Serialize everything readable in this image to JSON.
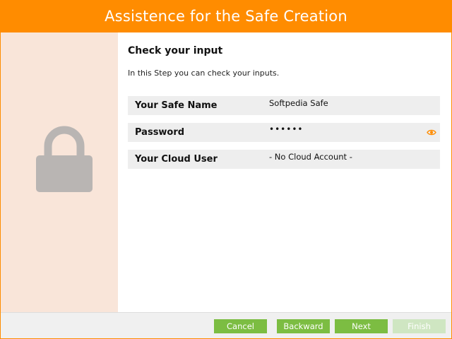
{
  "window": {
    "title": "Assistence for the Safe Creation",
    "accent_color": "#ff8c00",
    "side_panel_color": "#f9e5d9"
  },
  "side_panel": {
    "icon": "lock-icon"
  },
  "main": {
    "heading": "Check your input",
    "subtext": "In this Step you can check your inputs.",
    "rows": [
      {
        "label": "Your Safe Name",
        "value": "Softpedia Safe"
      },
      {
        "label": "Password",
        "value": "••••••",
        "icon": "eye-icon"
      },
      {
        "label": "Your Cloud User",
        "value": "- No Cloud Account -"
      }
    ]
  },
  "footer": {
    "cancel_label": "Cancel",
    "backward_label": "Backward",
    "next_label": "Next",
    "finish_label": "Finish",
    "button_color": "#7cbd42",
    "finish_enabled": false
  }
}
